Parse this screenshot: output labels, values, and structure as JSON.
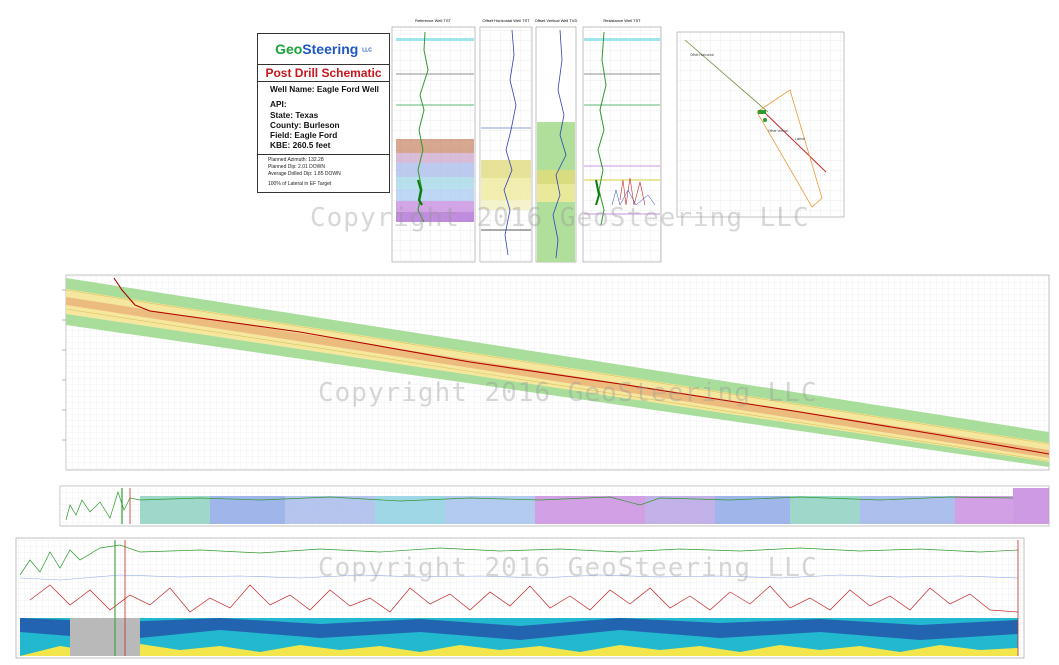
{
  "logo": {
    "geo": "Geo",
    "steering": "Steering",
    "llc": "LLC"
  },
  "schematic_title": "Post Drill Schematic",
  "well": {
    "name": "Well Name: Eagle Ford Well",
    "api": "API:",
    "state": "State: Texas",
    "county": "County: Burleson",
    "field": "Field: Eagle Ford",
    "kbe": "KBE: 260.5 feet"
  },
  "dips": {
    "planned_azimuth": "Planned Azimuth: 132.28",
    "planned_dip": "Planned Dip: 2.01 DOWN",
    "avg_dip": "Average Drilled Dip: 1.85 DOWN",
    "pct_in_target": "100% of Lateral in EF Target"
  },
  "log_tracks": [
    {
      "title": "Reference Well TST",
      "bg": "#ffffff",
      "curve": "#2f9a2f"
    },
    {
      "title": "Offset Horizontal Well TST",
      "bg": "#ffffff",
      "curve": "#2d44b8"
    },
    {
      "title": "Offset Vertical Well TVD",
      "bg": "#ffffff",
      "curve": "#2d44b8"
    },
    {
      "title": "Resistance Well TST",
      "bg": "#ffffff",
      "curve": "#2f9a2f"
    }
  ],
  "map": {
    "label_target": "Offset Horizontal",
    "label_lateral": "Lateral",
    "label_box": "Offset Vertical"
  },
  "watermarks": [
    "Copyright 2016 GeoSteering LLC",
    "Copyright 2016 GeoSteering LLC",
    "Copyright 2016 GeoSteering LLC"
  ],
  "colors": {
    "green_band": "#a9dd9c",
    "yellow_band": "#f6e79e",
    "orange_band": "#ecbc7e",
    "wellbore": "#b30000",
    "purple": "#c98fe0",
    "blue": "#8fa8e6",
    "gamma_red": "#c62828",
    "cyan": "#22b8cf"
  }
}
